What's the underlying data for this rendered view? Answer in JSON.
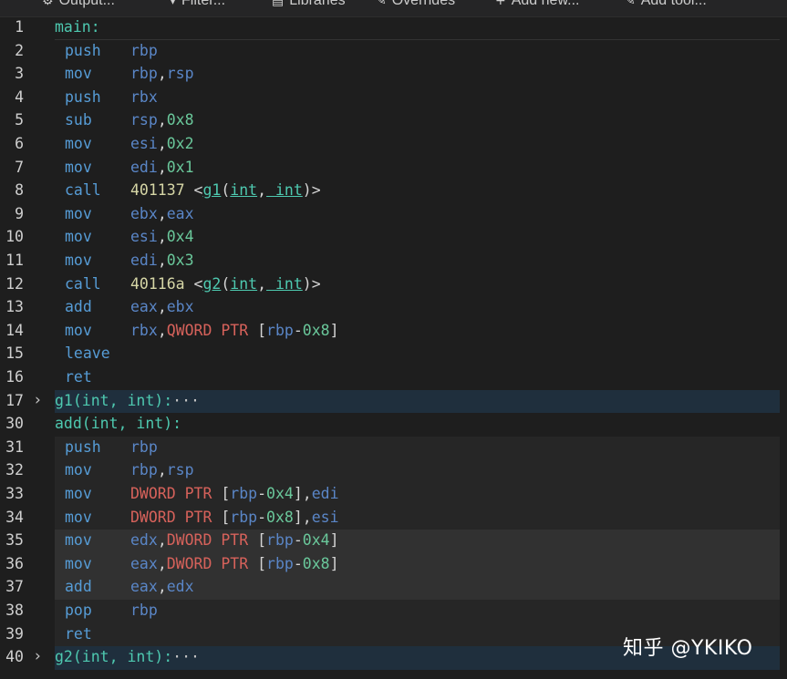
{
  "toolbar": {
    "items": [
      {
        "icon": "gear-icon",
        "label": "Output..."
      },
      {
        "icon": "filter-icon",
        "label": "Filter..."
      },
      {
        "icon": "book-icon",
        "label": "Libraries"
      },
      {
        "icon": "wrench-icon",
        "label": "Overrides"
      },
      {
        "icon": "plus-icon",
        "label": "Add new..."
      },
      {
        "icon": "tool-icon",
        "label": "Add tool..."
      }
    ]
  },
  "lines": [
    {
      "n": "1",
      "kind": "label",
      "text": "main:"
    },
    {
      "n": "2",
      "kind": "instr",
      "op": "push",
      "args": [
        [
          "reg",
          "rbp"
        ]
      ]
    },
    {
      "n": "3",
      "kind": "instr",
      "op": "mov",
      "args": [
        [
          "reg",
          "rbp"
        ],
        [
          "plain",
          ","
        ],
        [
          "reg",
          "rsp"
        ]
      ]
    },
    {
      "n": "4",
      "kind": "instr",
      "op": "push",
      "args": [
        [
          "reg",
          "rbx"
        ]
      ]
    },
    {
      "n": "5",
      "kind": "instr",
      "op": "sub",
      "args": [
        [
          "reg",
          "rsp"
        ],
        [
          "plain",
          ","
        ],
        [
          "num",
          "0x8"
        ]
      ]
    },
    {
      "n": "6",
      "kind": "instr",
      "op": "mov",
      "args": [
        [
          "reg",
          "esi"
        ],
        [
          "plain",
          ","
        ],
        [
          "num",
          "0x2"
        ]
      ]
    },
    {
      "n": "7",
      "kind": "instr",
      "op": "mov",
      "args": [
        [
          "reg",
          "edi"
        ],
        [
          "plain",
          ","
        ],
        [
          "num",
          "0x1"
        ]
      ]
    },
    {
      "n": "8",
      "kind": "instr",
      "op": "call",
      "args": [
        [
          "addr",
          "401137"
        ],
        [
          "plain",
          " <"
        ],
        [
          "fn",
          "g1"
        ],
        [
          "plain",
          "("
        ],
        [
          "fn",
          "int"
        ],
        [
          "plain",
          ","
        ],
        [
          "fn",
          " int"
        ],
        [
          "plain",
          ")>"
        ]
      ]
    },
    {
      "n": "9",
      "kind": "instr",
      "op": "mov",
      "args": [
        [
          "reg",
          "ebx"
        ],
        [
          "plain",
          ","
        ],
        [
          "reg",
          "eax"
        ]
      ]
    },
    {
      "n": "10",
      "kind": "instr",
      "op": "mov",
      "args": [
        [
          "reg",
          "esi"
        ],
        [
          "plain",
          ","
        ],
        [
          "num",
          "0x4"
        ]
      ]
    },
    {
      "n": "11",
      "kind": "instr",
      "op": "mov",
      "args": [
        [
          "reg",
          "edi"
        ],
        [
          "plain",
          ","
        ],
        [
          "num",
          "0x3"
        ]
      ]
    },
    {
      "n": "12",
      "kind": "instr",
      "op": "call",
      "args": [
        [
          "addr",
          "40116a"
        ],
        [
          "plain",
          " <"
        ],
        [
          "fn",
          "g2"
        ],
        [
          "plain",
          "("
        ],
        [
          "fn",
          "int"
        ],
        [
          "plain",
          ","
        ],
        [
          "fn",
          " int"
        ],
        [
          "plain",
          ")>"
        ]
      ]
    },
    {
      "n": "13",
      "kind": "instr",
      "op": "add",
      "args": [
        [
          "reg",
          "eax"
        ],
        [
          "plain",
          ","
        ],
        [
          "reg",
          "ebx"
        ]
      ]
    },
    {
      "n": "14",
      "kind": "instr",
      "op": "mov",
      "args": [
        [
          "reg",
          "rbx"
        ],
        [
          "plain",
          ","
        ],
        [
          "ptr",
          "QWORD PTR"
        ],
        [
          "plain",
          " ["
        ],
        [
          "reg",
          "rbp"
        ],
        [
          "plain",
          "-"
        ],
        [
          "num",
          "0x8"
        ],
        [
          "plain",
          "]"
        ]
      ]
    },
    {
      "n": "15",
      "kind": "instr",
      "op": "leave",
      "args": []
    },
    {
      "n": "16",
      "kind": "instr",
      "op": "ret",
      "args": []
    },
    {
      "n": "17",
      "kind": "folded",
      "text": "g1(int, int):",
      "ellipsis": "···",
      "hl": "fold"
    },
    {
      "n": "30",
      "kind": "label",
      "text": "add(int, int):"
    },
    {
      "n": "31",
      "kind": "instr",
      "op": "push",
      "args": [
        [
          "reg",
          "rbp"
        ]
      ],
      "hl": "a"
    },
    {
      "n": "32",
      "kind": "instr",
      "op": "mov",
      "args": [
        [
          "reg",
          "rbp"
        ],
        [
          "plain",
          ","
        ],
        [
          "reg",
          "rsp"
        ]
      ],
      "hl": "a"
    },
    {
      "n": "33",
      "kind": "instr",
      "op": "mov",
      "args": [
        [
          "ptr",
          "DWORD PTR"
        ],
        [
          "plain",
          " ["
        ],
        [
          "reg",
          "rbp"
        ],
        [
          "plain",
          "-"
        ],
        [
          "num",
          "0x4"
        ],
        [
          "plain",
          "],"
        ],
        [
          "reg",
          "edi"
        ]
      ],
      "hl": "a"
    },
    {
      "n": "34",
      "kind": "instr",
      "op": "mov",
      "args": [
        [
          "ptr",
          "DWORD PTR"
        ],
        [
          "plain",
          " ["
        ],
        [
          "reg",
          "rbp"
        ],
        [
          "plain",
          "-"
        ],
        [
          "num",
          "0x8"
        ],
        [
          "plain",
          "],"
        ],
        [
          "reg",
          "esi"
        ]
      ],
      "hl": "a"
    },
    {
      "n": "35",
      "kind": "instr",
      "op": "mov",
      "args": [
        [
          "reg",
          "edx"
        ],
        [
          "plain",
          ","
        ],
        [
          "ptr",
          "DWORD PTR"
        ],
        [
          "plain",
          " ["
        ],
        [
          "reg",
          "rbp"
        ],
        [
          "plain",
          "-"
        ],
        [
          "num",
          "0x4"
        ],
        [
          "plain",
          "]"
        ]
      ],
      "hl": "b"
    },
    {
      "n": "36",
      "kind": "instr",
      "op": "mov",
      "args": [
        [
          "reg",
          "eax"
        ],
        [
          "plain",
          ","
        ],
        [
          "ptr",
          "DWORD PTR"
        ],
        [
          "plain",
          " ["
        ],
        [
          "reg",
          "rbp"
        ],
        [
          "plain",
          "-"
        ],
        [
          "num",
          "0x8"
        ],
        [
          "plain",
          "]"
        ]
      ],
      "hl": "b"
    },
    {
      "n": "37",
      "kind": "instr",
      "op": "add",
      "args": [
        [
          "reg",
          "eax"
        ],
        [
          "plain",
          ","
        ],
        [
          "reg",
          "edx"
        ]
      ],
      "hl": "b"
    },
    {
      "n": "38",
      "kind": "instr",
      "op": "pop",
      "args": [
        [
          "reg",
          "rbp"
        ]
      ],
      "hl": "a"
    },
    {
      "n": "39",
      "kind": "instr",
      "op": "ret",
      "args": [],
      "hl": "a"
    },
    {
      "n": "40",
      "kind": "folded",
      "text": "g2(int, int):",
      "ellipsis": "···",
      "hl": "fold"
    }
  ],
  "watermark": "知乎 @YKIKO"
}
